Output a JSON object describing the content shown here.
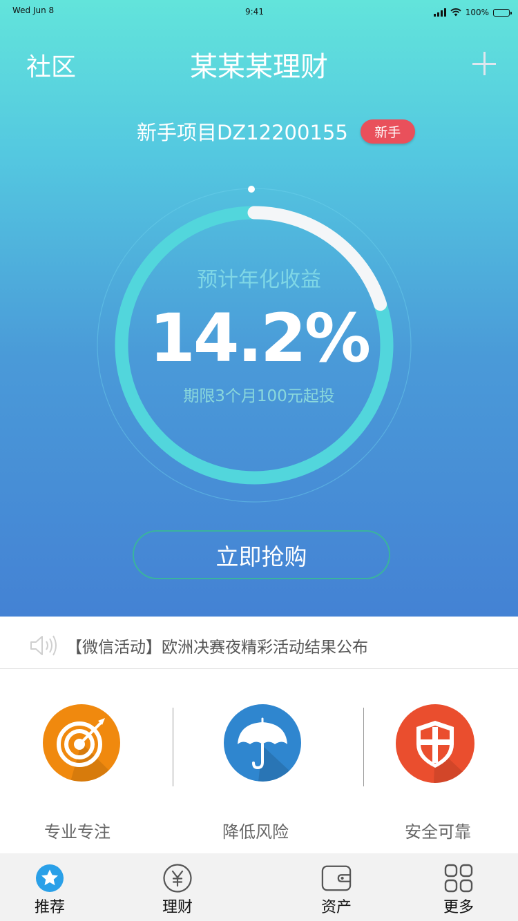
{
  "status_bar": {
    "date": "Wed Jun 8",
    "time": "9:41",
    "battery": "100%"
  },
  "nav": {
    "left": "社区",
    "title": "某某某理财",
    "add_icon": "plus-icon"
  },
  "project": {
    "name": "新手项目DZ12200155",
    "badge": "新手"
  },
  "progress": {
    "fraction": 0.2
  },
  "ring": {
    "label": "预计年化收益",
    "value": "14.2%",
    "subtitle": "期限3个月100元起投"
  },
  "buy_button": "立即抢购",
  "notice": {
    "icon": "speaker-icon",
    "text": "【微信活动】欧洲决赛夜精彩活动结果公布"
  },
  "features": [
    {
      "label": "专业专注",
      "icon": "target-icon",
      "color": "#f0890e"
    },
    {
      "label": "降低风险",
      "icon": "umbrella-icon",
      "color": "#2f86cf"
    },
    {
      "label": "安全可靠",
      "icon": "shield-icon",
      "color": "#ea4e2e"
    }
  ],
  "tabs": [
    {
      "label": "推荐",
      "icon": "star-icon",
      "active": true
    },
    {
      "label": "理财",
      "icon": "yen-icon",
      "active": false
    },
    {
      "label": "资产",
      "icon": "wallet-icon",
      "active": false
    },
    {
      "label": "更多",
      "icon": "grid-icon",
      "active": false
    }
  ],
  "colors": {
    "accent": "#2aa0e8",
    "badge": "#e9505b",
    "button_border": "#3ab49d"
  }
}
